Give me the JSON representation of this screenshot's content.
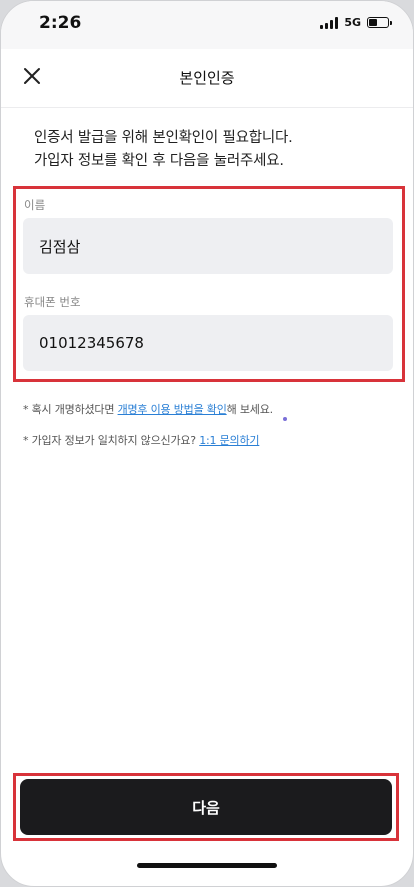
{
  "status_bar": {
    "time": "2:26",
    "network": "5G"
  },
  "header": {
    "title": "본인인증",
    "close_icon": "close-icon"
  },
  "intro": {
    "line1": "인증서 발급을 위해 본인확인이 필요합니다.",
    "line2": "가입자 정보를 확인 후 다음을 눌러주세요."
  },
  "form": {
    "name_label": "이름",
    "name_value": "김점삼",
    "phone_label": "휴대폰 번호",
    "phone_value": "01012345678"
  },
  "notes": {
    "note1_prefix": "* 혹시 개명하셨다면 ",
    "note1_link": "개명후 이용 방법을 확인",
    "note1_suffix": "해 보세요.",
    "note2_prefix": "* 가입자 정보가 일치하지 않으신가요? ",
    "note2_link": "1:1 문의하기"
  },
  "footer": {
    "next_label": "다음"
  },
  "colors": {
    "highlight_border": "#d8333a",
    "link": "#2a7fd5",
    "button_bg": "#1b1b1d"
  }
}
